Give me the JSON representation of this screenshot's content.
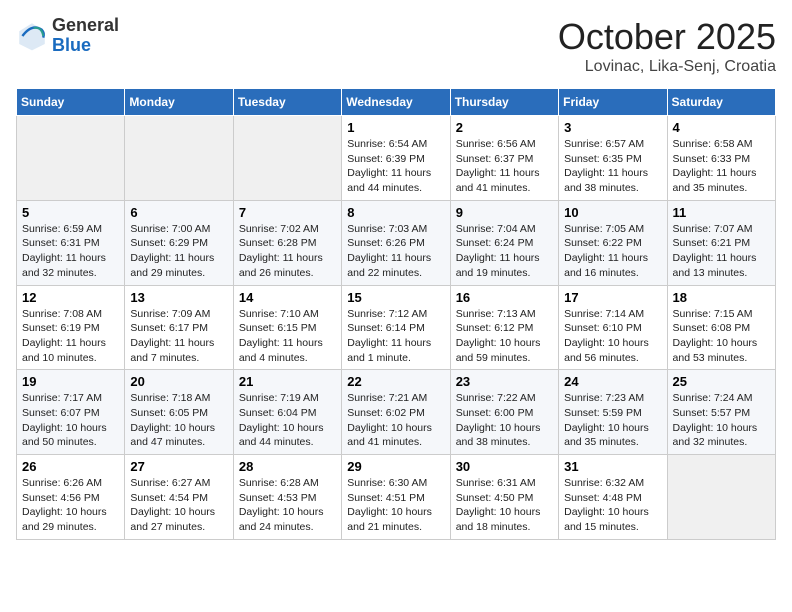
{
  "header": {
    "logo_general": "General",
    "logo_blue": "Blue",
    "month_title": "October 2025",
    "subtitle": "Lovinac, Lika-Senj, Croatia"
  },
  "calendar": {
    "weekdays": [
      "Sunday",
      "Monday",
      "Tuesday",
      "Wednesday",
      "Thursday",
      "Friday",
      "Saturday"
    ],
    "rows": [
      [
        {
          "day": "",
          "info": ""
        },
        {
          "day": "",
          "info": ""
        },
        {
          "day": "",
          "info": ""
        },
        {
          "day": "1",
          "info": "Sunrise: 6:54 AM\nSunset: 6:39 PM\nDaylight: 11 hours and 44 minutes."
        },
        {
          "day": "2",
          "info": "Sunrise: 6:56 AM\nSunset: 6:37 PM\nDaylight: 11 hours and 41 minutes."
        },
        {
          "day": "3",
          "info": "Sunrise: 6:57 AM\nSunset: 6:35 PM\nDaylight: 11 hours and 38 minutes."
        },
        {
          "day": "4",
          "info": "Sunrise: 6:58 AM\nSunset: 6:33 PM\nDaylight: 11 hours and 35 minutes."
        }
      ],
      [
        {
          "day": "5",
          "info": "Sunrise: 6:59 AM\nSunset: 6:31 PM\nDaylight: 11 hours and 32 minutes."
        },
        {
          "day": "6",
          "info": "Sunrise: 7:00 AM\nSunset: 6:29 PM\nDaylight: 11 hours and 29 minutes."
        },
        {
          "day": "7",
          "info": "Sunrise: 7:02 AM\nSunset: 6:28 PM\nDaylight: 11 hours and 26 minutes."
        },
        {
          "day": "8",
          "info": "Sunrise: 7:03 AM\nSunset: 6:26 PM\nDaylight: 11 hours and 22 minutes."
        },
        {
          "day": "9",
          "info": "Sunrise: 7:04 AM\nSunset: 6:24 PM\nDaylight: 11 hours and 19 minutes."
        },
        {
          "day": "10",
          "info": "Sunrise: 7:05 AM\nSunset: 6:22 PM\nDaylight: 11 hours and 16 minutes."
        },
        {
          "day": "11",
          "info": "Sunrise: 7:07 AM\nSunset: 6:21 PM\nDaylight: 11 hours and 13 minutes."
        }
      ],
      [
        {
          "day": "12",
          "info": "Sunrise: 7:08 AM\nSunset: 6:19 PM\nDaylight: 11 hours and 10 minutes."
        },
        {
          "day": "13",
          "info": "Sunrise: 7:09 AM\nSunset: 6:17 PM\nDaylight: 11 hours and 7 minutes."
        },
        {
          "day": "14",
          "info": "Sunrise: 7:10 AM\nSunset: 6:15 PM\nDaylight: 11 hours and 4 minutes."
        },
        {
          "day": "15",
          "info": "Sunrise: 7:12 AM\nSunset: 6:14 PM\nDaylight: 11 hours and 1 minute."
        },
        {
          "day": "16",
          "info": "Sunrise: 7:13 AM\nSunset: 6:12 PM\nDaylight: 10 hours and 59 minutes."
        },
        {
          "day": "17",
          "info": "Sunrise: 7:14 AM\nSunset: 6:10 PM\nDaylight: 10 hours and 56 minutes."
        },
        {
          "day": "18",
          "info": "Sunrise: 7:15 AM\nSunset: 6:08 PM\nDaylight: 10 hours and 53 minutes."
        }
      ],
      [
        {
          "day": "19",
          "info": "Sunrise: 7:17 AM\nSunset: 6:07 PM\nDaylight: 10 hours and 50 minutes."
        },
        {
          "day": "20",
          "info": "Sunrise: 7:18 AM\nSunset: 6:05 PM\nDaylight: 10 hours and 47 minutes."
        },
        {
          "day": "21",
          "info": "Sunrise: 7:19 AM\nSunset: 6:04 PM\nDaylight: 10 hours and 44 minutes."
        },
        {
          "day": "22",
          "info": "Sunrise: 7:21 AM\nSunset: 6:02 PM\nDaylight: 10 hours and 41 minutes."
        },
        {
          "day": "23",
          "info": "Sunrise: 7:22 AM\nSunset: 6:00 PM\nDaylight: 10 hours and 38 minutes."
        },
        {
          "day": "24",
          "info": "Sunrise: 7:23 AM\nSunset: 5:59 PM\nDaylight: 10 hours and 35 minutes."
        },
        {
          "day": "25",
          "info": "Sunrise: 7:24 AM\nSunset: 5:57 PM\nDaylight: 10 hours and 32 minutes."
        }
      ],
      [
        {
          "day": "26",
          "info": "Sunrise: 6:26 AM\nSunset: 4:56 PM\nDaylight: 10 hours and 29 minutes."
        },
        {
          "day": "27",
          "info": "Sunrise: 6:27 AM\nSunset: 4:54 PM\nDaylight: 10 hours and 27 minutes."
        },
        {
          "day": "28",
          "info": "Sunrise: 6:28 AM\nSunset: 4:53 PM\nDaylight: 10 hours and 24 minutes."
        },
        {
          "day": "29",
          "info": "Sunrise: 6:30 AM\nSunset: 4:51 PM\nDaylight: 10 hours and 21 minutes."
        },
        {
          "day": "30",
          "info": "Sunrise: 6:31 AM\nSunset: 4:50 PM\nDaylight: 10 hours and 18 minutes."
        },
        {
          "day": "31",
          "info": "Sunrise: 6:32 AM\nSunset: 4:48 PM\nDaylight: 10 hours and 15 minutes."
        },
        {
          "day": "",
          "info": ""
        }
      ]
    ]
  }
}
